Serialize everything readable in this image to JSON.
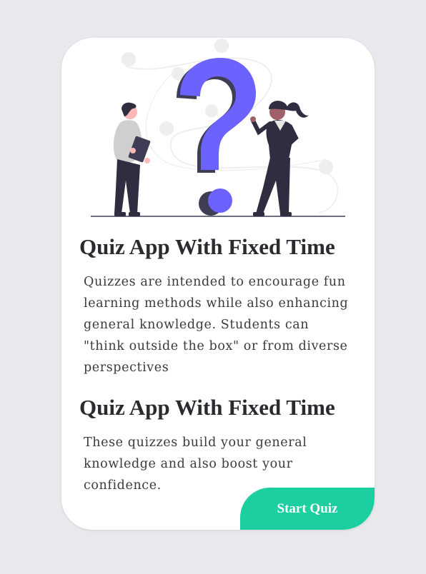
{
  "card": {
    "illustration": "person-question-mark-illustration",
    "sections": [
      {
        "title": "Quiz App With Fixed Time",
        "text": "Quizzes are intended to encourage fun learning methods while also enhancing general knowledge. Students can \"think outside the box\" or from diverse perspectives"
      },
      {
        "title": "Quiz App With Fixed Time",
        "text": "These quizzes build your general knowledge and also boost your confidence."
      }
    ],
    "start_button_label": "Start Quiz"
  },
  "colors": {
    "accent": "#1ccfa0",
    "question_mark": "#6c63ff",
    "background": "#e8e9ed",
    "card": "#ffffff",
    "text": "#2b2b2f"
  }
}
